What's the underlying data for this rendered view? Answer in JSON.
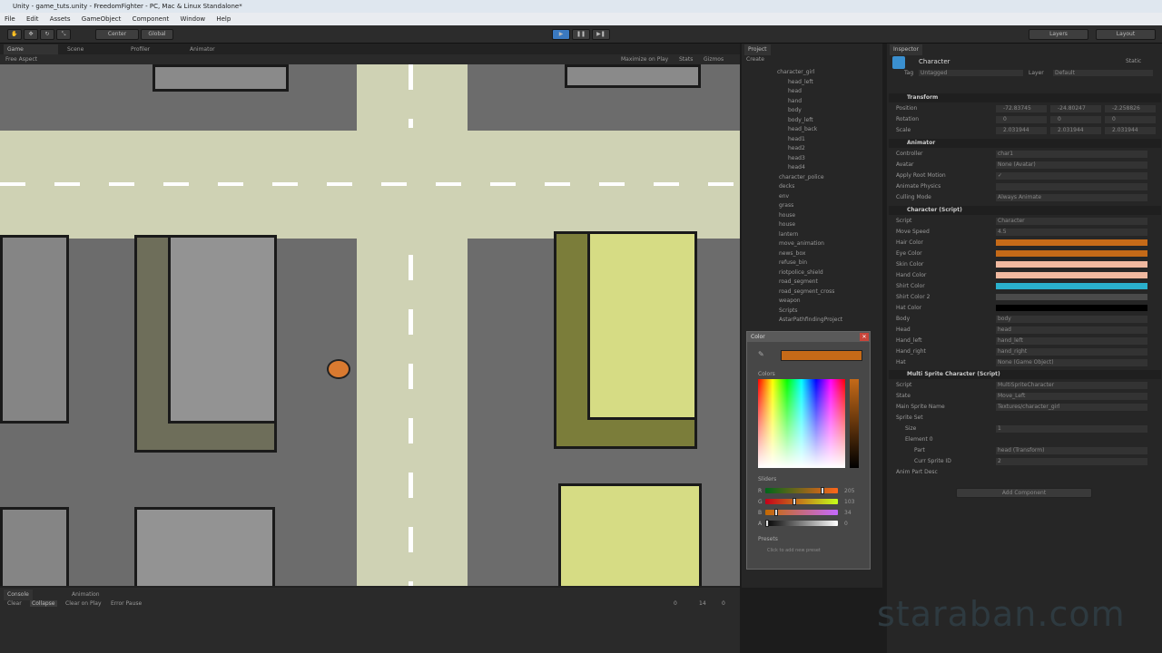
{
  "window": {
    "title": "Unity - game_tuts.unity - FreedomFighter - PC, Mac & Linux Standalone*"
  },
  "menu": [
    "File",
    "Edit",
    "Assets",
    "GameObject",
    "Component",
    "Window",
    "Help"
  ],
  "toolbar": {
    "pivot": "Center",
    "space": "Global",
    "layers": "Layers",
    "layout": "Layout"
  },
  "game_tabs": [
    "Game",
    "Scene",
    "Profiler",
    "Animator"
  ],
  "game_bar": {
    "aspect": "Free Aspect",
    "maximize": "Maximize on Play",
    "stats": "Stats",
    "gizmos": "Gizmos"
  },
  "project": {
    "title": "Project",
    "create": "Create",
    "items": [
      {
        "label": "character_girl"
      },
      {
        "label": "head_left"
      },
      {
        "label": "head"
      },
      {
        "label": "hand"
      },
      {
        "label": "body"
      },
      {
        "label": "body_left"
      },
      {
        "label": "head_back"
      },
      {
        "label": "head1"
      },
      {
        "label": "head2"
      },
      {
        "label": "head3"
      },
      {
        "label": "head4"
      },
      {
        "label": "character_police"
      },
      {
        "label": "decks"
      },
      {
        "label": "env"
      },
      {
        "label": "grass"
      },
      {
        "label": "house"
      },
      {
        "label": "house"
      },
      {
        "label": "lantern"
      },
      {
        "label": "move_animation"
      },
      {
        "label": "news_box"
      },
      {
        "label": "refuse_bin"
      },
      {
        "label": "riotpolice_shield"
      },
      {
        "label": "road_segment"
      },
      {
        "label": "road_segment_cross"
      },
      {
        "label": "weapon"
      },
      {
        "label": "Scripts"
      },
      {
        "label": "AstarPathfindingProject"
      }
    ]
  },
  "inspector": {
    "title": "Inspector",
    "object_name": "Character",
    "static": "Static",
    "tag_label": "Tag",
    "tag_value": "Untagged",
    "layer_label": "Layer",
    "layer_value": "Default",
    "transform": {
      "title": "Transform",
      "position_label": "Position",
      "position": [
        "-72.83745",
        "-24.80247",
        "-2.258826"
      ],
      "rotation_label": "Rotation",
      "rotation": [
        "0",
        "0",
        "0"
      ],
      "scale_label": "Scale",
      "scale": [
        "2.031944",
        "2.031944",
        "2.031944"
      ]
    },
    "animator": {
      "title": "Animator",
      "rows": [
        {
          "label": "Controller",
          "value": "char1"
        },
        {
          "label": "Avatar",
          "value": "None (Avatar)"
        },
        {
          "label": "Apply Root Motion",
          "value": "✓"
        },
        {
          "label": "Animate Physics",
          "value": ""
        },
        {
          "label": "Culling Mode",
          "value": "Always Animate"
        }
      ]
    },
    "character": {
      "title": "Character (Script)",
      "script_label": "Script",
      "script_value": "Character",
      "speed_label": "Move Speed",
      "speed_value": "4.5",
      "colors": [
        {
          "label": "Hair Color",
          "hex": "#c56a18"
        },
        {
          "label": "Eye Color",
          "hex": "#c56a18"
        },
        {
          "label": "Skin Color",
          "hex": "#f0b9a0"
        },
        {
          "label": "Hand Color",
          "hex": "#f0b9a0"
        },
        {
          "label": "Shirt Color",
          "hex": "#2ab0cc"
        },
        {
          "label": "Shirt Color 2",
          "hex": "#4a4a4a"
        },
        {
          "label": "Hat Color",
          "hex": "#000000"
        }
      ],
      "refs": [
        {
          "label": "Body",
          "value": "body"
        },
        {
          "label": "Head",
          "value": "head"
        },
        {
          "label": "Hand_left",
          "value": "hand_left"
        },
        {
          "label": "Hand_right",
          "value": "hand_right"
        },
        {
          "label": "Hat",
          "value": "None (Game Object)"
        }
      ]
    },
    "multisprite": {
      "title": "Multi Sprite Character (Script)",
      "rows": [
        {
          "label": "Script",
          "value": "MultiSpriteCharacter"
        },
        {
          "label": "State",
          "value": "Move_Left"
        },
        {
          "label": "Main Sprite Name",
          "value": "Textures/character_girl"
        },
        {
          "label": "Sprite Set",
          "value": ""
        },
        {
          "label": "Size",
          "value": "1"
        },
        {
          "label": "Element 0",
          "value": ""
        },
        {
          "label": "Part",
          "value": "head (Transform)"
        },
        {
          "label": "Curr Sprite ID",
          "value": "2"
        },
        {
          "label": "Anim Part Desc",
          "value": ""
        }
      ]
    },
    "add_component": "Add Component"
  },
  "color_window": {
    "title": "Color",
    "current_hex": "#c56a18",
    "colors_label": "Colors",
    "sliders_label": "Sliders",
    "sliders": [
      {
        "label": "R",
        "value": "205",
        "fraction": 0.8
      },
      {
        "label": "G",
        "value": "103",
        "fraction": 0.4
      },
      {
        "label": "B",
        "value": "34",
        "fraction": 0.13
      },
      {
        "label": "A",
        "value": "0",
        "fraction": 0.0
      }
    ],
    "presets_label": "Presets",
    "presets_hint": "Click to add new preset"
  },
  "console": {
    "tabs": [
      "Console",
      "Animation"
    ],
    "buttons": [
      "Clear",
      "Collapse",
      "Clear on Play",
      "Error Pause"
    ],
    "counts": [
      "0",
      "14",
      "0"
    ]
  },
  "watermark": "staraban.com"
}
